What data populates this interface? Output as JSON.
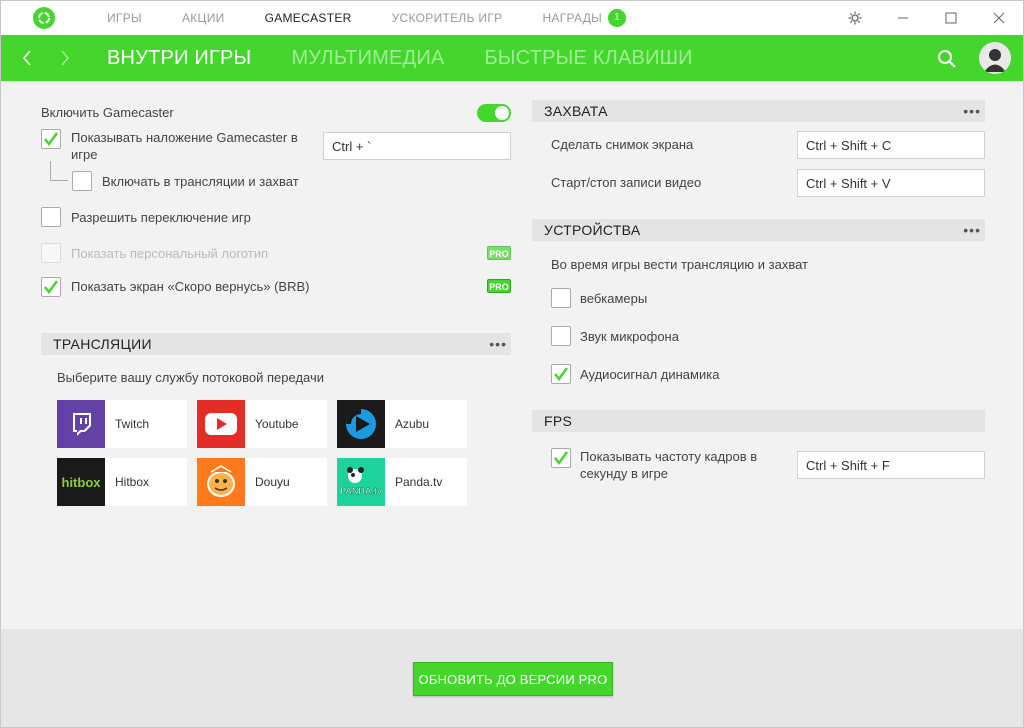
{
  "topnav": {
    "items": [
      "ИГРЫ",
      "АКЦИИ",
      "GAMECASTER",
      "УСКОРИТЕЛЬ ИГР",
      "НАГРАДЫ"
    ],
    "active": "GAMECASTER",
    "rewards_badge": "1"
  },
  "subnav": {
    "tabs": [
      "ВНУТРИ ИГРЫ",
      "МУЛЬТИМЕДИА",
      "БЫСТРЫЕ КЛАВИШИ"
    ],
    "active": "ВНУТРИ ИГРЫ"
  },
  "general": {
    "enable_gamecaster": "Включить Gamecaster",
    "enable_gamecaster_on": true,
    "show_overlay": "Показывать наложение Gamecaster в игре",
    "show_overlay_checked": true,
    "overlay_hotkey": "Ctrl + `",
    "include_in_stream": "Включать в трансляции и захват",
    "include_in_stream_checked": false,
    "allow_game_switch": "Разрешить переключение игр",
    "allow_game_switch_checked": false,
    "show_personal_logo": "Показать персональный логотип",
    "show_personal_logo_checked": false,
    "show_brb": "Показать экран «Скоро вернусь» (BRB)",
    "show_brb_checked": true,
    "pro_label": "PRO"
  },
  "broadcasts": {
    "title": "ТРАНСЛЯЦИИ",
    "prompt": "Выберите вашу службу потоковой передачи",
    "services": [
      {
        "name": "Twitch",
        "icon": "twitch-icon",
        "color": "#6441a5"
      },
      {
        "name": "Youtube",
        "icon": "youtube-icon",
        "color": "#e52d27"
      },
      {
        "name": "Azubu",
        "icon": "azubu-icon",
        "color": "#1a1a1a"
      },
      {
        "name": "Hitbox",
        "icon": "hitbox-icon",
        "color": "#1a1a1a"
      },
      {
        "name": "Douyu",
        "icon": "douyu-icon",
        "color": "#ff7a1a"
      },
      {
        "name": "Panda.tv",
        "icon": "panda-icon",
        "color": "#1cd39b"
      }
    ]
  },
  "capture": {
    "title": "ЗАХВАТА",
    "screenshot_label": "Сделать снимок экрана",
    "screenshot_hotkey": "Ctrl + Shift + C",
    "record_label": "Старт/стоп записи видео",
    "record_hotkey": "Ctrl + Shift + V"
  },
  "devices": {
    "title": "УСТРОЙСТВА",
    "prompt": "Во время игры вести трансляцию и захват",
    "webcam": "вебкамеры",
    "webcam_checked": false,
    "mic": "Звук микрофона",
    "mic_checked": false,
    "speaker": "Аудиосигнал динамика",
    "speaker_checked": true
  },
  "fps": {
    "title": "FPS",
    "show_fps": "Показывать частоту кадров в секунду в игре",
    "show_fps_checked": true,
    "fps_hotkey": "Ctrl + Shift + F"
  },
  "footer": {
    "upgrade_label": "ОБНОВИТЬ ДО ВЕРСИИ PRO"
  },
  "colors": {
    "accent": "#44d62c"
  }
}
